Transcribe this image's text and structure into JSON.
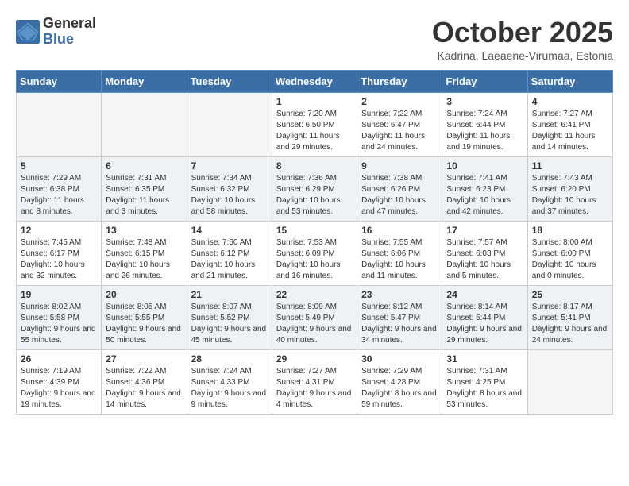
{
  "logo": {
    "general": "General",
    "blue": "Blue"
  },
  "header": {
    "month": "October 2025",
    "location": "Kadrina, Laeaene-Virumaa, Estonia"
  },
  "weekdays": [
    "Sunday",
    "Monday",
    "Tuesday",
    "Wednesday",
    "Thursday",
    "Friday",
    "Saturday"
  ],
  "weeks": [
    [
      {
        "day": "",
        "sunrise": "",
        "sunset": "",
        "daylight": "",
        "empty": true
      },
      {
        "day": "",
        "sunrise": "",
        "sunset": "",
        "daylight": "",
        "empty": true
      },
      {
        "day": "",
        "sunrise": "",
        "sunset": "",
        "daylight": "",
        "empty": true
      },
      {
        "day": "1",
        "sunrise": "Sunrise: 7:20 AM",
        "sunset": "Sunset: 6:50 PM",
        "daylight": "Daylight: 11 hours and 29 minutes.",
        "empty": false
      },
      {
        "day": "2",
        "sunrise": "Sunrise: 7:22 AM",
        "sunset": "Sunset: 6:47 PM",
        "daylight": "Daylight: 11 hours and 24 minutes.",
        "empty": false
      },
      {
        "day": "3",
        "sunrise": "Sunrise: 7:24 AM",
        "sunset": "Sunset: 6:44 PM",
        "daylight": "Daylight: 11 hours and 19 minutes.",
        "empty": false
      },
      {
        "day": "4",
        "sunrise": "Sunrise: 7:27 AM",
        "sunset": "Sunset: 6:41 PM",
        "daylight": "Daylight: 11 hours and 14 minutes.",
        "empty": false
      }
    ],
    [
      {
        "day": "5",
        "sunrise": "Sunrise: 7:29 AM",
        "sunset": "Sunset: 6:38 PM",
        "daylight": "Daylight: 11 hours and 8 minutes.",
        "empty": false
      },
      {
        "day": "6",
        "sunrise": "Sunrise: 7:31 AM",
        "sunset": "Sunset: 6:35 PM",
        "daylight": "Daylight: 11 hours and 3 minutes.",
        "empty": false
      },
      {
        "day": "7",
        "sunrise": "Sunrise: 7:34 AM",
        "sunset": "Sunset: 6:32 PM",
        "daylight": "Daylight: 10 hours and 58 minutes.",
        "empty": false
      },
      {
        "day": "8",
        "sunrise": "Sunrise: 7:36 AM",
        "sunset": "Sunset: 6:29 PM",
        "daylight": "Daylight: 10 hours and 53 minutes.",
        "empty": false
      },
      {
        "day": "9",
        "sunrise": "Sunrise: 7:38 AM",
        "sunset": "Sunset: 6:26 PM",
        "daylight": "Daylight: 10 hours and 47 minutes.",
        "empty": false
      },
      {
        "day": "10",
        "sunrise": "Sunrise: 7:41 AM",
        "sunset": "Sunset: 6:23 PM",
        "daylight": "Daylight: 10 hours and 42 minutes.",
        "empty": false
      },
      {
        "day": "11",
        "sunrise": "Sunrise: 7:43 AM",
        "sunset": "Sunset: 6:20 PM",
        "daylight": "Daylight: 10 hours and 37 minutes.",
        "empty": false
      }
    ],
    [
      {
        "day": "12",
        "sunrise": "Sunrise: 7:45 AM",
        "sunset": "Sunset: 6:17 PM",
        "daylight": "Daylight: 10 hours and 32 minutes.",
        "empty": false
      },
      {
        "day": "13",
        "sunrise": "Sunrise: 7:48 AM",
        "sunset": "Sunset: 6:15 PM",
        "daylight": "Daylight: 10 hours and 26 minutes.",
        "empty": false
      },
      {
        "day": "14",
        "sunrise": "Sunrise: 7:50 AM",
        "sunset": "Sunset: 6:12 PM",
        "daylight": "Daylight: 10 hours and 21 minutes.",
        "empty": false
      },
      {
        "day": "15",
        "sunrise": "Sunrise: 7:53 AM",
        "sunset": "Sunset: 6:09 PM",
        "daylight": "Daylight: 10 hours and 16 minutes.",
        "empty": false
      },
      {
        "day": "16",
        "sunrise": "Sunrise: 7:55 AM",
        "sunset": "Sunset: 6:06 PM",
        "daylight": "Daylight: 10 hours and 11 minutes.",
        "empty": false
      },
      {
        "day": "17",
        "sunrise": "Sunrise: 7:57 AM",
        "sunset": "Sunset: 6:03 PM",
        "daylight": "Daylight: 10 hours and 5 minutes.",
        "empty": false
      },
      {
        "day": "18",
        "sunrise": "Sunrise: 8:00 AM",
        "sunset": "Sunset: 6:00 PM",
        "daylight": "Daylight: 10 hours and 0 minutes.",
        "empty": false
      }
    ],
    [
      {
        "day": "19",
        "sunrise": "Sunrise: 8:02 AM",
        "sunset": "Sunset: 5:58 PM",
        "daylight": "Daylight: 9 hours and 55 minutes.",
        "empty": false
      },
      {
        "day": "20",
        "sunrise": "Sunrise: 8:05 AM",
        "sunset": "Sunset: 5:55 PM",
        "daylight": "Daylight: 9 hours and 50 minutes.",
        "empty": false
      },
      {
        "day": "21",
        "sunrise": "Sunrise: 8:07 AM",
        "sunset": "Sunset: 5:52 PM",
        "daylight": "Daylight: 9 hours and 45 minutes.",
        "empty": false
      },
      {
        "day": "22",
        "sunrise": "Sunrise: 8:09 AM",
        "sunset": "Sunset: 5:49 PM",
        "daylight": "Daylight: 9 hours and 40 minutes.",
        "empty": false
      },
      {
        "day": "23",
        "sunrise": "Sunrise: 8:12 AM",
        "sunset": "Sunset: 5:47 PM",
        "daylight": "Daylight: 9 hours and 34 minutes.",
        "empty": false
      },
      {
        "day": "24",
        "sunrise": "Sunrise: 8:14 AM",
        "sunset": "Sunset: 5:44 PM",
        "daylight": "Daylight: 9 hours and 29 minutes.",
        "empty": false
      },
      {
        "day": "25",
        "sunrise": "Sunrise: 8:17 AM",
        "sunset": "Sunset: 5:41 PM",
        "daylight": "Daylight: 9 hours and 24 minutes.",
        "empty": false
      }
    ],
    [
      {
        "day": "26",
        "sunrise": "Sunrise: 7:19 AM",
        "sunset": "Sunset: 4:39 PM",
        "daylight": "Daylight: 9 hours and 19 minutes.",
        "empty": false
      },
      {
        "day": "27",
        "sunrise": "Sunrise: 7:22 AM",
        "sunset": "Sunset: 4:36 PM",
        "daylight": "Daylight: 9 hours and 14 minutes.",
        "empty": false
      },
      {
        "day": "28",
        "sunrise": "Sunrise: 7:24 AM",
        "sunset": "Sunset: 4:33 PM",
        "daylight": "Daylight: 9 hours and 9 minutes.",
        "empty": false
      },
      {
        "day": "29",
        "sunrise": "Sunrise: 7:27 AM",
        "sunset": "Sunset: 4:31 PM",
        "daylight": "Daylight: 9 hours and 4 minutes.",
        "empty": false
      },
      {
        "day": "30",
        "sunrise": "Sunrise: 7:29 AM",
        "sunset": "Sunset: 4:28 PM",
        "daylight": "Daylight: 8 hours and 59 minutes.",
        "empty": false
      },
      {
        "day": "31",
        "sunrise": "Sunrise: 7:31 AM",
        "sunset": "Sunset: 4:25 PM",
        "daylight": "Daylight: 8 hours and 53 minutes.",
        "empty": false
      },
      {
        "day": "",
        "sunrise": "",
        "sunset": "",
        "daylight": "",
        "empty": true
      }
    ]
  ]
}
